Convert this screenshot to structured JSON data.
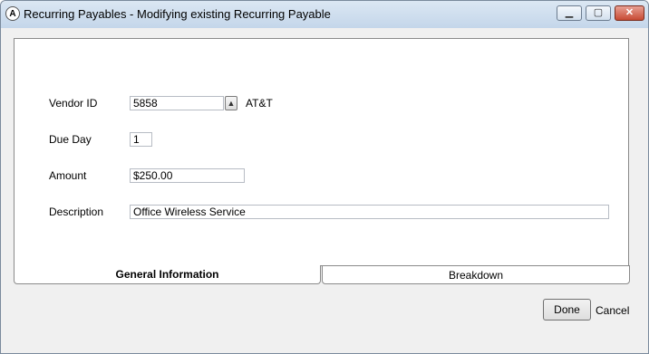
{
  "window": {
    "title": "Recurring Payables - Modifying existing Recurring Payable",
    "icon": "app-logo-icon",
    "controls": {
      "minimize": "minimize-icon",
      "maximize": "maximize-icon",
      "close": "close-icon"
    }
  },
  "form": {
    "vendor_id_label": "Vendor ID",
    "vendor_id_value": "5858",
    "vendor_name": "AT&T",
    "due_day_label": "Due Day",
    "due_day_value": "1",
    "amount_label": "Amount",
    "amount_value": "$250.00",
    "description_label": "Description",
    "description_value": "Office Wireless Service"
  },
  "tabs": [
    {
      "label": "General Information",
      "selected": true
    },
    {
      "label": "Breakdown",
      "selected": false
    }
  ],
  "buttons": {
    "done": "Done",
    "cancel": "Cancel"
  }
}
